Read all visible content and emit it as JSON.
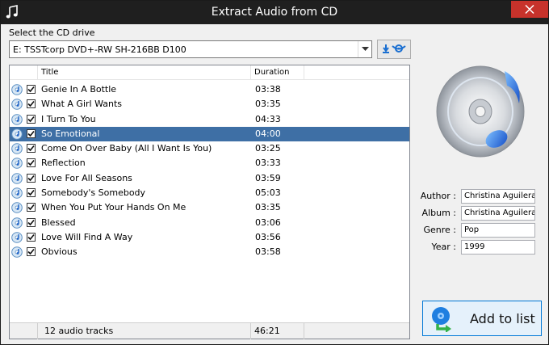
{
  "window": {
    "title": "Extract Audio from CD"
  },
  "drive": {
    "label": "Select the CD drive",
    "selected": "E: TSSTcorp DVD+-RW SH-216BB D100"
  },
  "columns": {
    "title": "Title",
    "duration": "Duration"
  },
  "tracks": [
    {
      "title": "Genie In A Bottle",
      "duration": "03:38",
      "checked": true,
      "selected": false
    },
    {
      "title": "What A Girl Wants",
      "duration": "03:35",
      "checked": true,
      "selected": false
    },
    {
      "title": "I Turn To You",
      "duration": "04:33",
      "checked": true,
      "selected": false
    },
    {
      "title": "So Emotional",
      "duration": "04:00",
      "checked": true,
      "selected": true
    },
    {
      "title": "Come On Over Baby (All I Want Is You)",
      "duration": "03:25",
      "checked": true,
      "selected": false
    },
    {
      "title": "Reflection",
      "duration": "03:33",
      "checked": true,
      "selected": false
    },
    {
      "title": "Love For All Seasons",
      "duration": "03:59",
      "checked": true,
      "selected": false
    },
    {
      "title": "Somebody's Somebody",
      "duration": "05:03",
      "checked": true,
      "selected": false
    },
    {
      "title": "When You Put Your Hands On Me",
      "duration": "03:35",
      "checked": true,
      "selected": false
    },
    {
      "title": "Blessed",
      "duration": "03:06",
      "checked": true,
      "selected": false
    },
    {
      "title": "Love Will Find A Way",
      "duration": "03:56",
      "checked": true,
      "selected": false
    },
    {
      "title": "Obvious",
      "duration": "03:58",
      "checked": true,
      "selected": false
    }
  ],
  "footer": {
    "count": "12 audio tracks",
    "total": "46:21"
  },
  "meta": {
    "author_label": "Author :",
    "author": "Christina Aguilera",
    "album_label": "Album :",
    "album": "Christina Aguilera",
    "genre_label": "Genre :",
    "genre": "Pop",
    "year_label": "Year :",
    "year": "1999"
  },
  "add_button": {
    "label": "Add to list"
  },
  "icons": {
    "app": "music-note-icon",
    "close": "close-icon",
    "dropdown": "chevron-down-icon",
    "eject": "eject-icon",
    "track": "cd-track-icon",
    "check": "checkmark-icon",
    "art": "cd-music-icon",
    "add": "add-to-list-icon"
  },
  "colors": {
    "titlebar": "#1f1f1f",
    "close": "#c7322b",
    "selection": "#3e6fa5",
    "accent": "#0078d7"
  }
}
